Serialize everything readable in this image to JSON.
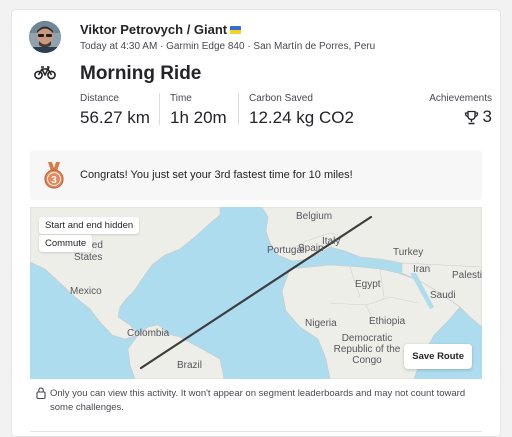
{
  "activity": {
    "athlete_name": "Viktor Petrovych / Giant",
    "meta": "Today at 4:30 AM · Garmin Edge 840 · San Martín de Porres, Peru",
    "title": "Morning Ride",
    "type_icon": "bike-icon"
  },
  "stats": [
    {
      "label": "Distance",
      "value": "56.27 km"
    },
    {
      "label": "Time",
      "value": "1h 20m"
    },
    {
      "label": "Carbon Saved",
      "value": "12.24 kg CO2"
    }
  ],
  "achievements": {
    "label": "Achievements",
    "count": "3",
    "icon": "trophy-icon"
  },
  "congrats": {
    "medal_number": "3",
    "text": "Congrats! You just set your 3rd fastest time for 10 miles!"
  },
  "map": {
    "badges": [
      "Start and end hidden",
      "Commute"
    ],
    "save_route_label": "Save Route",
    "labels": [
      "Belgium",
      "Italy",
      "Portugal",
      "Spain",
      "Turkey",
      "Iran",
      "Palestine",
      "Egypt",
      "Saudi",
      "United States",
      "Mexico",
      "Colombia",
      "Brazil",
      "Nigeria",
      "Ethiopia",
      "Democratic Republic of the Congo"
    ],
    "route_color": "#3d3d3d"
  },
  "privacy": {
    "text": "Only you can view this activity. It won't appear on segment leaderboards and may not count toward some challenges."
  }
}
